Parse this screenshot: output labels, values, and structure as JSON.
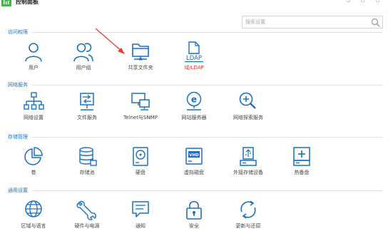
{
  "header": {
    "title": "控制面板"
  },
  "search": {
    "placeholder": "搜索设置"
  },
  "colors": {
    "accent": "#1a73c8",
    "icon": "#1a6fc0",
    "highlight": "#e33b2e",
    "logo": "#4caf50"
  },
  "sections": [
    {
      "title": "访问权限",
      "items": [
        {
          "label": "用户",
          "icon": "user-icon"
        },
        {
          "label": "用户组",
          "icon": "user-group-icon"
        },
        {
          "label": "共享文件夹",
          "icon": "shared-folder-icon"
        },
        {
          "label": "域/LDAP",
          "icon": "ldap-icon"
        }
      ]
    },
    {
      "title": "网络服务",
      "items": [
        {
          "label": "网络设置",
          "icon": "network-icon"
        },
        {
          "label": "文件服务",
          "icon": "file-service-icon"
        },
        {
          "label": "Telnet与SNMP",
          "icon": "telnet-snmp-icon"
        },
        {
          "label": "网站服务器",
          "icon": "web-server-icon"
        },
        {
          "label": "网络探索服务",
          "icon": "network-discovery-icon"
        }
      ]
    },
    {
      "title": "存储管理",
      "items": [
        {
          "label": "卷",
          "icon": "volume-icon"
        },
        {
          "label": "存储池",
          "icon": "storage-pool-icon"
        },
        {
          "label": "硬盘",
          "icon": "hard-disk-icon"
        },
        {
          "label": "虚拟磁盘",
          "icon": "virtual-disk-icon"
        },
        {
          "label": "外接存储设备",
          "icon": "external-storage-icon"
        },
        {
          "label": "热备盘",
          "icon": "hot-spare-icon"
        }
      ]
    },
    {
      "title": "通用设置",
      "items": [
        {
          "label": "区域与语言",
          "icon": "globe-icon"
        },
        {
          "label": "硬件与电源",
          "icon": "hardware-power-icon"
        },
        {
          "label": "通知",
          "icon": "notification-icon"
        },
        {
          "label": "安全",
          "icon": "security-icon"
        },
        {
          "label": "更新与还原",
          "icon": "update-restore-icon"
        }
      ]
    }
  ]
}
